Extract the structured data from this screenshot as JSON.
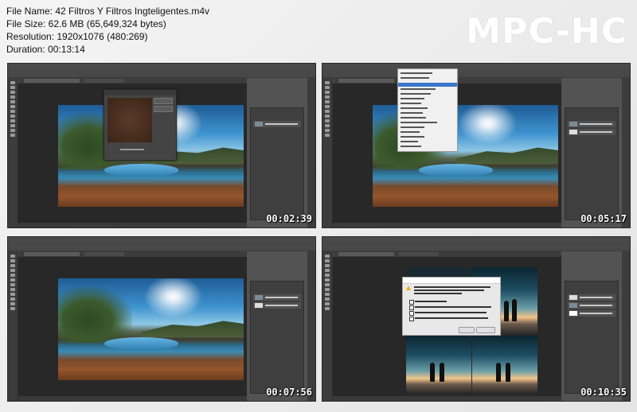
{
  "info": {
    "file_name": "File Name: 42 Filtros Y Filtros Ingteligentes.m4v",
    "file_size": "File Size: 62.6 MB (65,649,324 bytes)",
    "resolution": "Resolution: 1920x1076 (480:269)",
    "duration": "Duration: 00:13:14"
  },
  "brand": "MPC-HC",
  "thumbnails": [
    {
      "timestamp": "00:02:39"
    },
    {
      "timestamp": "00:05:17"
    },
    {
      "timestamp": "00:07:56"
    },
    {
      "timestamp": "00:10:35"
    }
  ],
  "colors": {
    "ps_workspace": "#535353",
    "ps_panel_dark": "#3c3c3c",
    "menu_highlight": "#3a76c9",
    "brand_text": "#ffffff"
  }
}
